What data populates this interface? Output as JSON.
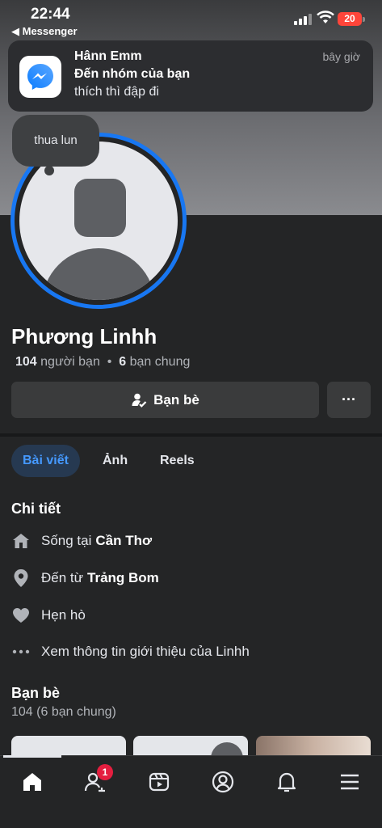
{
  "status_bar": {
    "time": "22:44",
    "back_app": "◀ Messenger",
    "battery": "20"
  },
  "notification": {
    "sender": "Hânn Emm",
    "group": "Đến nhóm của bạn",
    "message": "thích thì đập đi",
    "time": "bây giờ",
    "app_icon": "messenger-icon"
  },
  "status_bubble": {
    "text": "thua lun"
  },
  "profile": {
    "name": "Phương Linhh",
    "friends_count": "104",
    "friends_label": "người bạn",
    "mutual_count": "6",
    "mutual_label": "bạn chung"
  },
  "actions": {
    "friend_button": "Bạn bè",
    "more_button": "···"
  },
  "tabs": [
    {
      "label": "Bài viết",
      "active": true
    },
    {
      "label": "Ảnh",
      "active": false
    },
    {
      "label": "Reels",
      "active": false
    }
  ],
  "details": {
    "title": "Chi tiết",
    "items": [
      {
        "icon": "home-icon",
        "text": "Sống tại",
        "bold": "Cần Thơ"
      },
      {
        "icon": "location-pin-icon",
        "text": "Đến từ",
        "bold": "Trảng Bom"
      },
      {
        "icon": "heart-icon",
        "text": "Hẹn hò",
        "bold": ""
      },
      {
        "icon": "more-dots-icon",
        "text": "Xem thông tin giới thiệu của Linhh",
        "bold": ""
      }
    ]
  },
  "friends": {
    "title": "Bạn bè",
    "count_text": "104 (6 bạn chung)"
  },
  "bottom_nav": {
    "items": [
      {
        "icon": "home-icon",
        "active": true
      },
      {
        "icon": "friends-icon",
        "badge": "1"
      },
      {
        "icon": "video-icon"
      },
      {
        "icon": "profile-icon"
      },
      {
        "icon": "bell-icon"
      },
      {
        "icon": "menu-icon"
      }
    ]
  },
  "colors": {
    "accent": "#1877f2",
    "background": "#242526",
    "badge": "#e41e3f"
  }
}
